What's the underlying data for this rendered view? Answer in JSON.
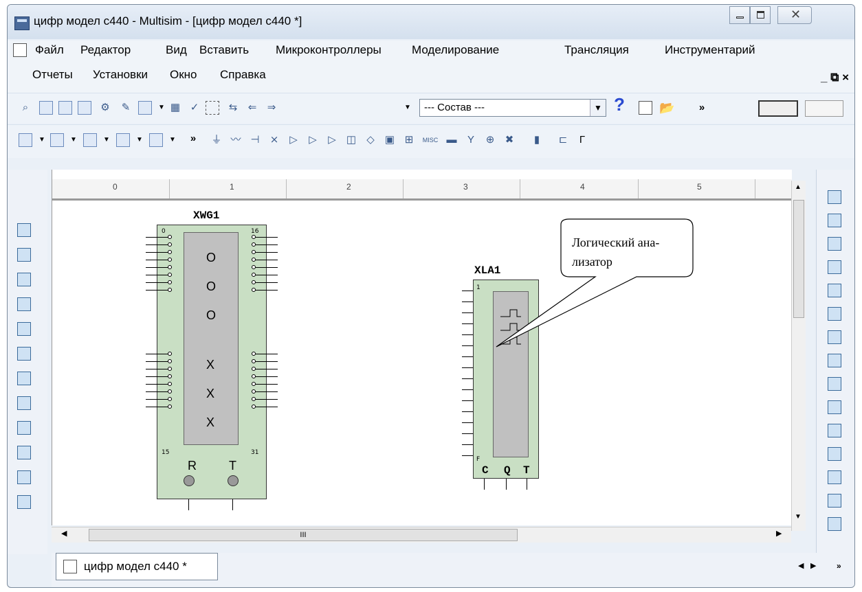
{
  "window": {
    "title": "цифр модел с440 - Multisim - [цифр модел с440 *]"
  },
  "menu": {
    "row1": [
      "Файл",
      "Редактор",
      "Вид",
      "Вставить",
      "Микроконтроллеры",
      "Моделирование",
      "Трансляция",
      "Инструментарий"
    ],
    "row2": [
      "Отчеты",
      "Установки",
      "Окно",
      "Справка"
    ],
    "mdi_controls": "_ ⧉ ×"
  },
  "toolbar": {
    "component_select": "--- Состав ---",
    "more_label": "»",
    "misc_label": "MISC"
  },
  "ruler": {
    "marks": [
      "0",
      "1",
      "2",
      "3",
      "4",
      "5"
    ]
  },
  "components": {
    "word_generator": {
      "ref": "XWG1",
      "top_left_pin": "0",
      "top_right_pin": "16",
      "bottom_left_pin": "15",
      "bottom_right_pin": "31",
      "screen_chars": [
        "O",
        "O",
        "O",
        "X",
        "X",
        "X"
      ],
      "terminal_r": "R",
      "terminal_t": "T"
    },
    "logic_analyzer": {
      "ref": "XLA1",
      "top_pin": "1",
      "bottom_pin": "F",
      "terminals": [
        "C",
        "Q",
        "T"
      ]
    }
  },
  "callout": {
    "line1": "Логический ана-",
    "line2": "лизатор"
  },
  "hscroll": {
    "thumb_grip": "III"
  },
  "tabs": {
    "active": "цифр модел с440 *"
  }
}
